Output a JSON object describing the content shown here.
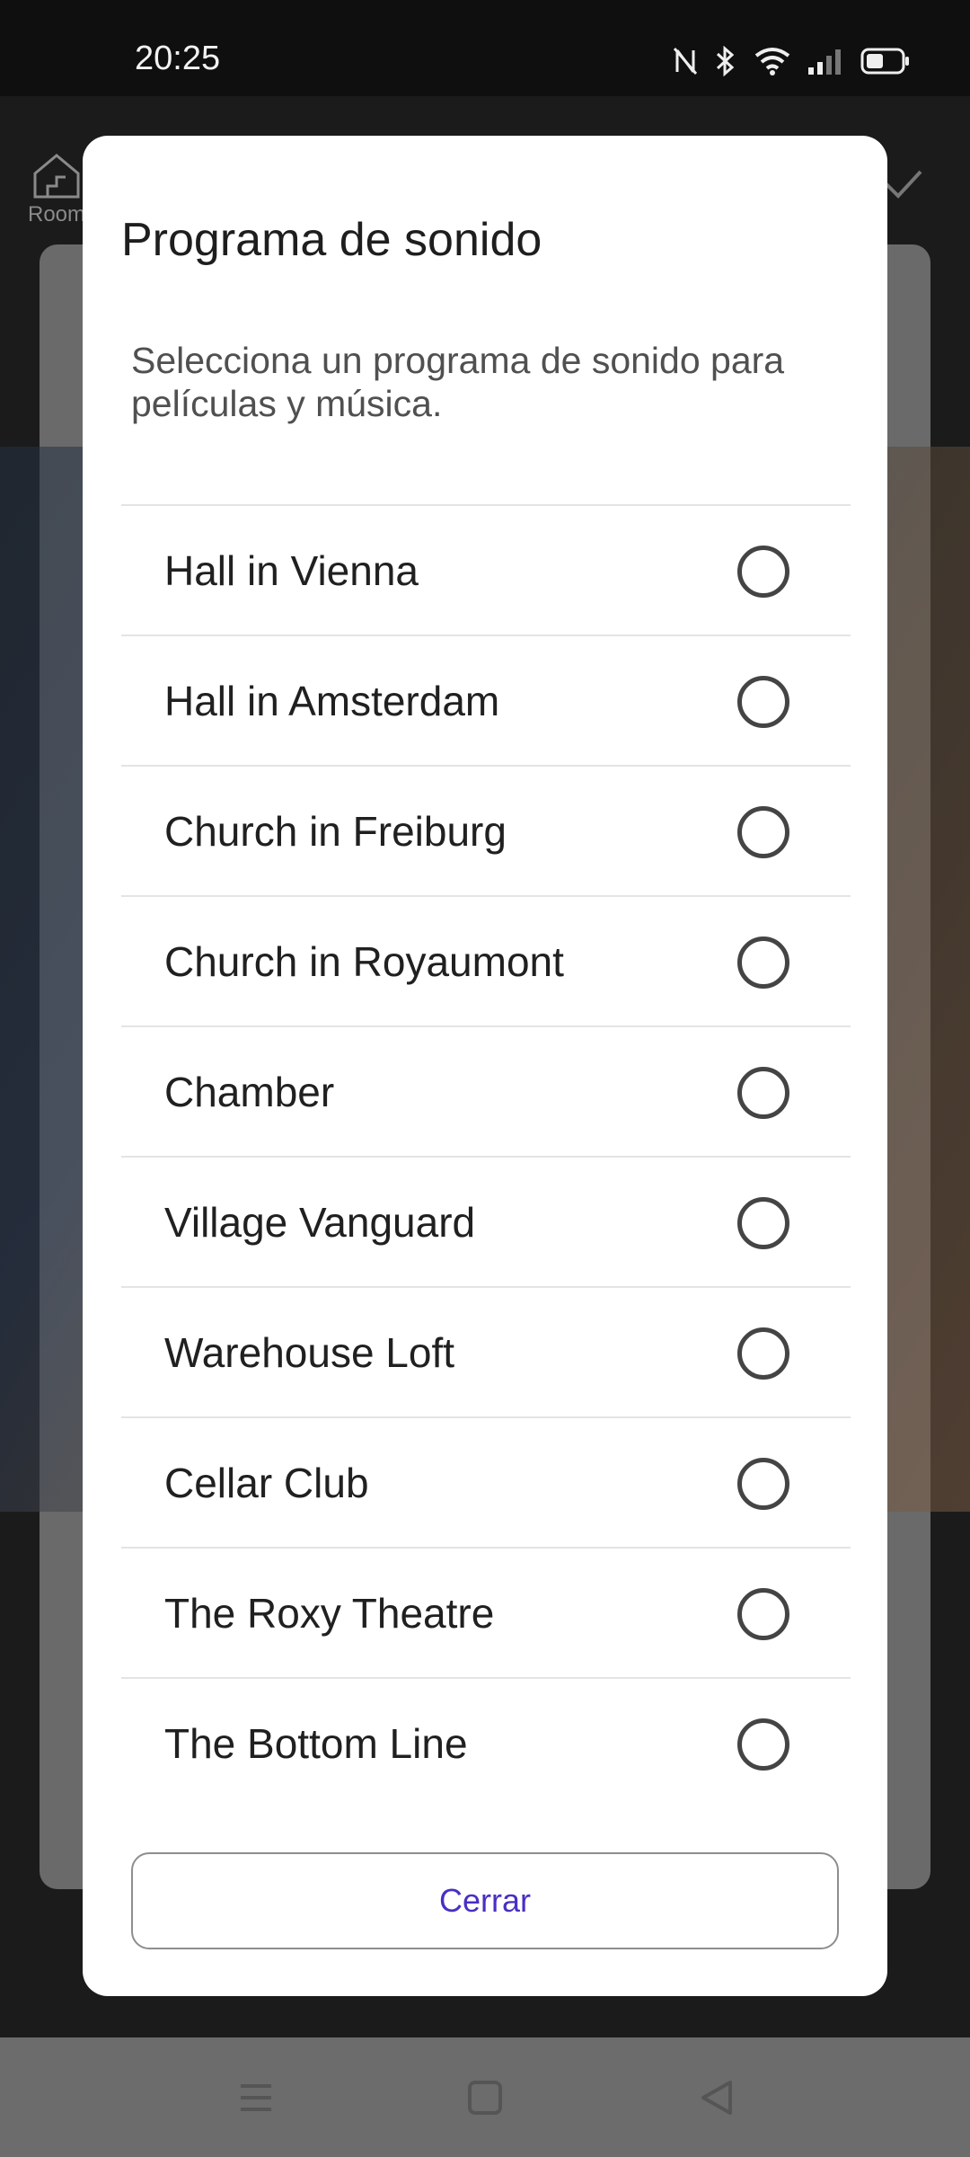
{
  "status_bar": {
    "time": "20:25",
    "icons": [
      "nfc-icon",
      "bluetooth-icon",
      "wifi-icon",
      "signal-icon",
      "battery-icon"
    ]
  },
  "background": {
    "room_label": "Room"
  },
  "dialog": {
    "title": "Programa de sonido",
    "description": "Selecciona un programa de sonido para películas y música.",
    "options": [
      {
        "label": "Hall in Vienna"
      },
      {
        "label": "Hall in Amsterdam"
      },
      {
        "label": "Church in Freiburg"
      },
      {
        "label": "Church in Royaumont"
      },
      {
        "label": "Chamber"
      },
      {
        "label": "Village Vanguard"
      },
      {
        "label": "Warehouse Loft"
      },
      {
        "label": "Cellar Club"
      },
      {
        "label": "The Roxy Theatre"
      },
      {
        "label": "The Bottom Line"
      }
    ],
    "close_label": "Cerrar"
  },
  "colors": {
    "accent": "#4a2fc4",
    "scrim": "#1b1b1b"
  }
}
